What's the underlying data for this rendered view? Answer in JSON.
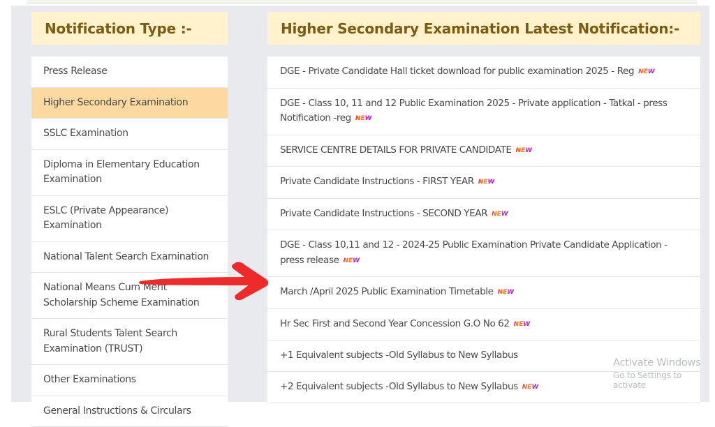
{
  "left_panel": {
    "title": "Notification Type :-",
    "items": [
      {
        "label": "Press Release",
        "active": false
      },
      {
        "label": "Higher Secondary Examination",
        "active": true
      },
      {
        "label": "SSLC Examination",
        "active": false
      },
      {
        "label": "Diploma in Elementary Education Examination",
        "active": false
      },
      {
        "label": "ESLC (Private Appearance) Examination",
        "active": false
      },
      {
        "label": "National Talent Search Examination",
        "active": false
      },
      {
        "label": "National Means Cum Merit Scholarship Scheme Examination",
        "active": false
      },
      {
        "label": "Rural Students Talent Search Examination (TRUST)",
        "active": false
      },
      {
        "label": "Other Examinations",
        "active": false
      },
      {
        "label": "General Instructions & Circulars",
        "active": false
      }
    ]
  },
  "right_panel": {
    "title": "Higher Secondary Examination Latest Notification:-",
    "new_badge_label": "NEW",
    "items": [
      {
        "label": "DGE - Private Candidate Hall ticket download for public examination 2025 - Reg",
        "is_new": true
      },
      {
        "label": "DGE - Class 10, 11 and 12 Public Examination 2025 - Private application - Tatkal - press Notification -reg",
        "is_new": true
      },
      {
        "label": "SERVICE CENTRE DETAILS FOR PRIVATE CANDIDATE",
        "is_new": true
      },
      {
        "label": "Private Candidate Instructions - FIRST YEAR",
        "is_new": true
      },
      {
        "label": "Private Candidate Instructions - SECOND YEAR",
        "is_new": true
      },
      {
        "label": "DGE - Class 10,11 and 12 - 2024-25 Public Examination Private Candidate Application - press release",
        "is_new": true
      },
      {
        "label": "March /April 2025 Public Examination Timetable",
        "is_new": true
      },
      {
        "label": "Hr Sec First and Second Year Concession G.O No 62",
        "is_new": true
      },
      {
        "label": "+1 Equivalent subjects -Old Syllabus to New Syllabus",
        "is_new": false
      },
      {
        "label": "+2 Equivalent subjects -Old Syllabus to New Syllabus",
        "is_new": true
      }
    ]
  },
  "annotation": {
    "arrow_icon": "red-arrow-right",
    "arrow_color": "#ee2a2a"
  },
  "watermark": {
    "line1": "Activate Windows",
    "line2": "Go to Settings to activate"
  },
  "colors": {
    "header_bg": "#fff2cc",
    "header_text": "#7a5c12",
    "active_item_bg": "#fcd9a0",
    "panel_bg": "#e9eaee"
  }
}
